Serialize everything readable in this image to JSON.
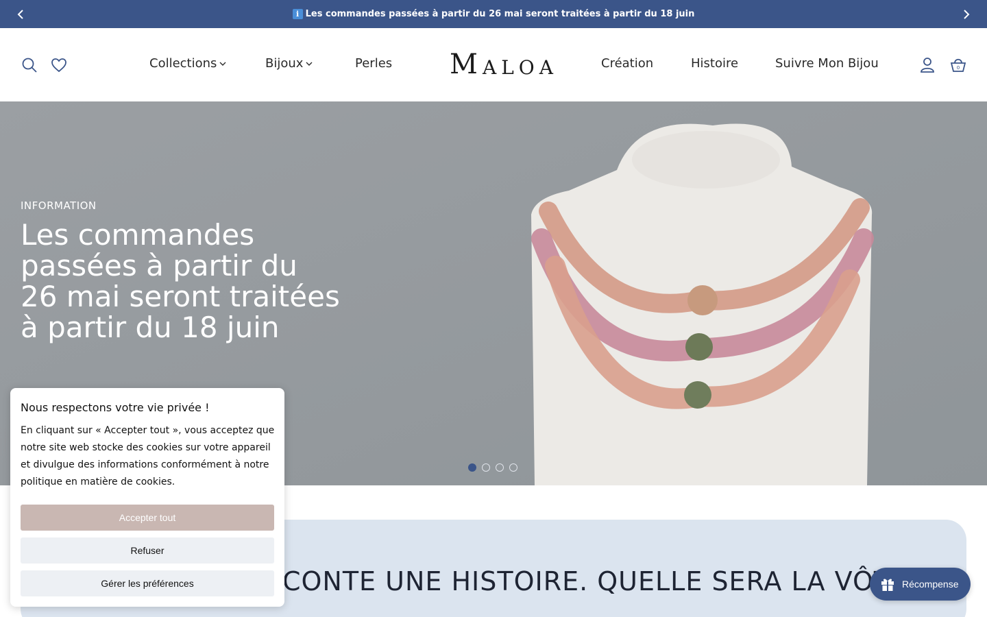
{
  "announcement": {
    "icon": "info-icon",
    "text": "Les commandes passées à partir du 26 mai seront traitées à partir du 18 juin",
    "background": "#3b5589"
  },
  "header": {
    "logo": {
      "first": "M",
      "rest": "ALOA"
    },
    "nav_left": [
      {
        "label": "Collections",
        "dropdown": true
      },
      {
        "label": "Bijoux",
        "dropdown": true
      },
      {
        "label": "Perles",
        "dropdown": false
      }
    ],
    "nav_right": [
      {
        "label": "Création"
      },
      {
        "label": "Histoire"
      },
      {
        "label": "Suivre Mon Bijou"
      }
    ],
    "icons": [
      "search-icon",
      "heart-icon",
      "account-icon",
      "cart-icon"
    ]
  },
  "hero": {
    "kicker": "INFORMATION",
    "headline": "Les commandes passées à partir du 26 mai seront traitées à partir du 18 juin",
    "slides": 4,
    "active_slide": 1
  },
  "story": {
    "heading": "CHAQUE BIJOU RACONTE UNE HISTOIRE. QUELLE SERA LA VÔTRE ?"
  },
  "cookie": {
    "title": "Nous respectons votre vie privée !",
    "body": "En cliquant sur « Accepter tout », vous acceptez que notre site web stocke des cookies sur votre appareil et divulgue des informations conformément à notre politique en matière de cookies.",
    "accept": "Accepter tout",
    "refuse": "Refuser",
    "preferences": "Gérer les préférences"
  },
  "reward": {
    "label": "Récompense",
    "icon": "gift-icon"
  },
  "colors": {
    "brand": "#3b5589",
    "accept": "#c9b7b2",
    "story_bg": "#dbe4ef"
  }
}
